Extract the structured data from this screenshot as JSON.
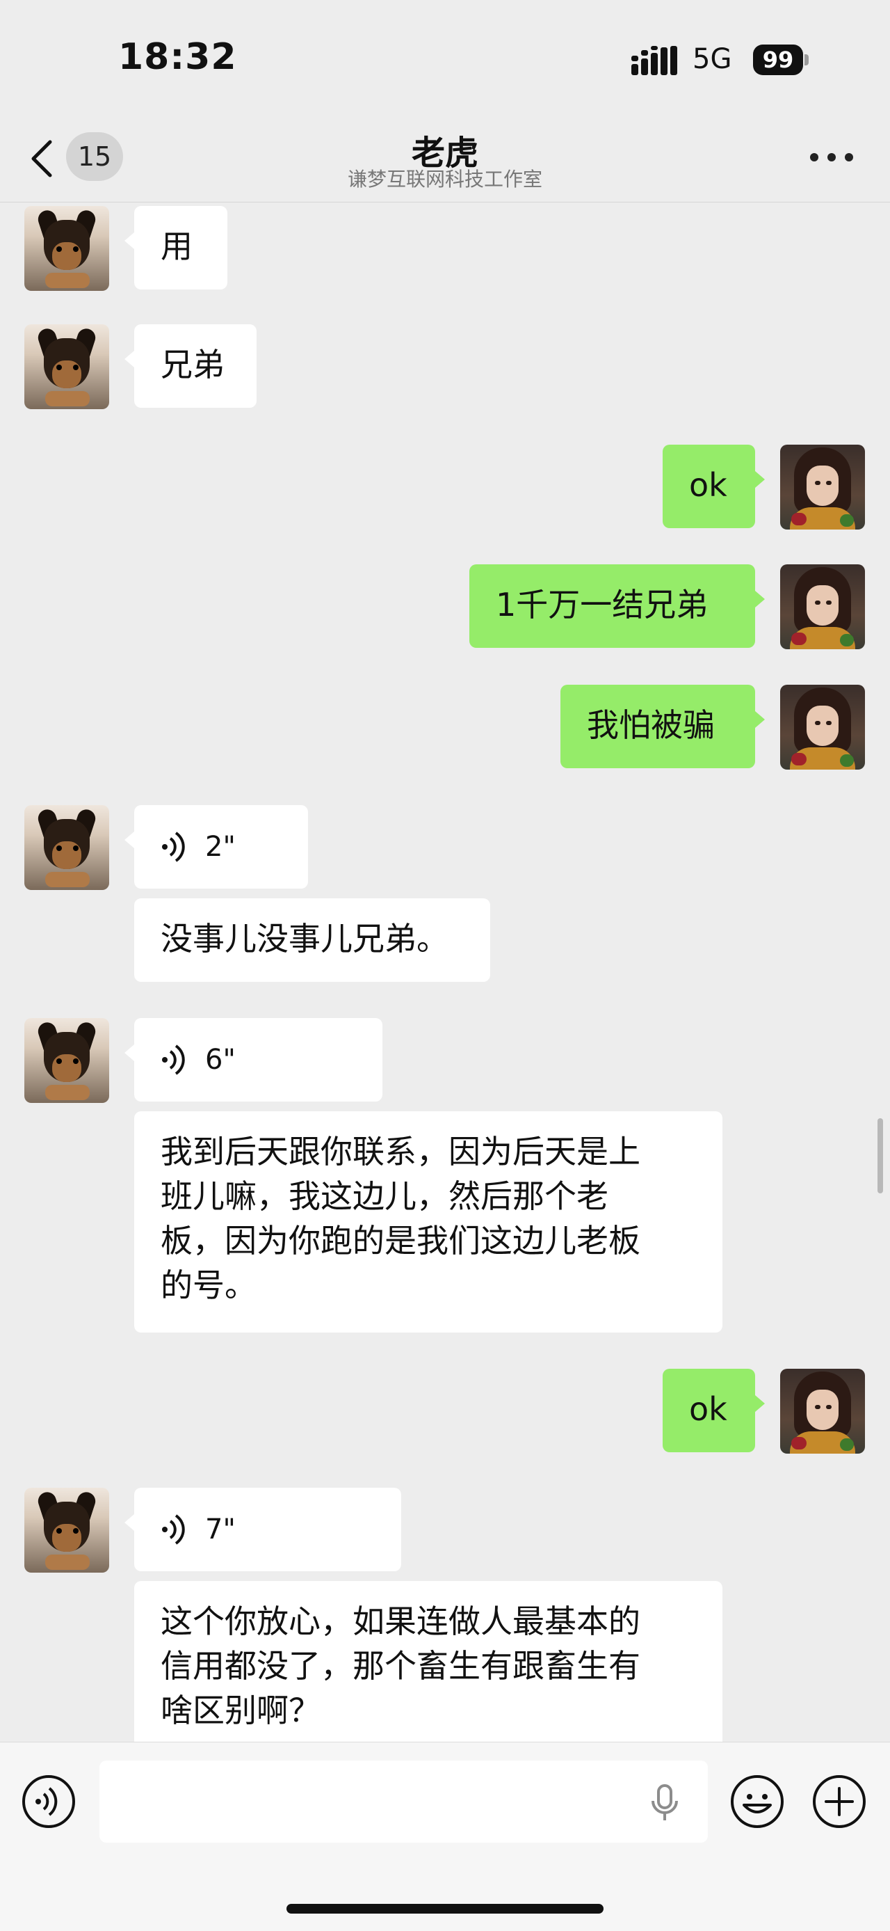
{
  "status_bar": {
    "time": "18:32",
    "network": "5G",
    "battery": "99"
  },
  "nav": {
    "unread_count": "15",
    "title": "老虎",
    "subtitle": "谦梦互联网科技工作室"
  },
  "messages": [
    {
      "side": "left",
      "type": "text",
      "text": "用"
    },
    {
      "side": "left",
      "type": "text",
      "text": "兄弟"
    },
    {
      "side": "right",
      "type": "text",
      "text": "ok"
    },
    {
      "side": "right",
      "type": "text",
      "text": "1千万一结兄弟"
    },
    {
      "side": "right",
      "type": "text",
      "text": "我怕被骗"
    },
    {
      "side": "left",
      "type": "voice",
      "duration": "2\""
    },
    {
      "side": "left",
      "type": "text",
      "text": "没事儿没事儿兄弟。"
    },
    {
      "side": "left",
      "type": "voice",
      "duration": "6\""
    },
    {
      "side": "left",
      "type": "text",
      "text": "我到后天跟你联系，因为后天是上\n班儿嘛，我这边儿，然后那个老\n板，因为你跑的是我们这边儿老板\n的号。"
    },
    {
      "side": "right",
      "type": "text",
      "text": "ok"
    },
    {
      "side": "left",
      "type": "voice",
      "duration": "7\""
    },
    {
      "side": "left",
      "type": "text",
      "text": "这个你放心，如果连做人最基本的\n信用都没了，那个畜生有跟畜生有\n啥区别啊？"
    }
  ],
  "input_bar": {
    "voice_button_icon": "voice-mode-icon",
    "mic_icon": "microphone-icon",
    "emoji_icon": "emoji-icon",
    "plus_icon": "plus-icon"
  },
  "colors": {
    "background": "#ededed",
    "incoming_bubble": "#ffffff",
    "outgoing_bubble": "#95ec69"
  }
}
